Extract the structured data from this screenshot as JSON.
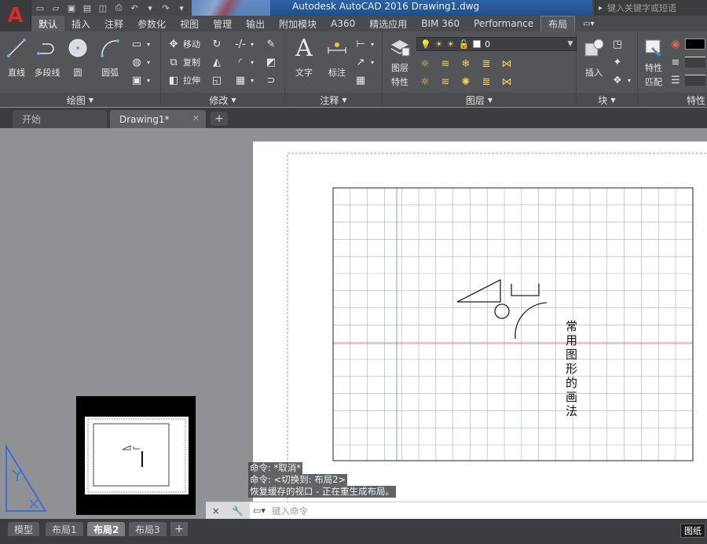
{
  "app": {
    "logo": "A",
    "title": "Autodesk AutoCAD 2016    Drawing1.dwg",
    "search_placeholder": "键入关键字或短语"
  },
  "ribbon_tabs": [
    "默认",
    "插入",
    "注释",
    "参数化",
    "视图",
    "管理",
    "输出",
    "附加模块",
    "A360",
    "精选应用",
    "BIM 360",
    "Performance",
    "布局"
  ],
  "ribbon_tab_extra": "▭▾",
  "panels": {
    "draw": {
      "title": "绘图",
      "tools": [
        "直线",
        "多段线",
        "圆",
        "圆弧"
      ]
    },
    "modify": {
      "title": "修改",
      "tools": [
        "移动",
        "复制",
        "拉伸"
      ]
    },
    "annotation": {
      "title": "注释",
      "tools": [
        "文字",
        "标注"
      ]
    },
    "layers": {
      "title": "图层",
      "props_label_1": "图层",
      "props_label_2": "特性",
      "current_layer": "0"
    },
    "block": {
      "title": "块",
      "insert_label": "插入"
    },
    "properties": {
      "title": "特性",
      "match_label_1": "特性",
      "match_label_2": "匹配"
    }
  },
  "file_tabs": [
    {
      "label": "开始"
    },
    {
      "label": "Drawing1*"
    }
  ],
  "drawing": {
    "vertical_text": [
      "常",
      "用",
      "图",
      "形",
      "的",
      "画",
      "法"
    ]
  },
  "command_history": [
    "命令: *取消*",
    "命令:   <切换到: 布局2>",
    "恢复缓存的视口 - 正在重生成布局。"
  ],
  "command_line": {
    "placeholder": "键入命令",
    "close_icon": "×",
    "settings_icon": "wrench"
  },
  "layout_tabs": [
    "模型",
    "布局1",
    "布局2",
    "布局3"
  ],
  "active_layout": "布局2",
  "status": {
    "paper_button": "图纸"
  },
  "colors": {
    "accent_red": "#d32a2a",
    "title_blue": "#2d63a8",
    "grid": "#a8b0b4",
    "axis_red": "#c88a8a"
  }
}
